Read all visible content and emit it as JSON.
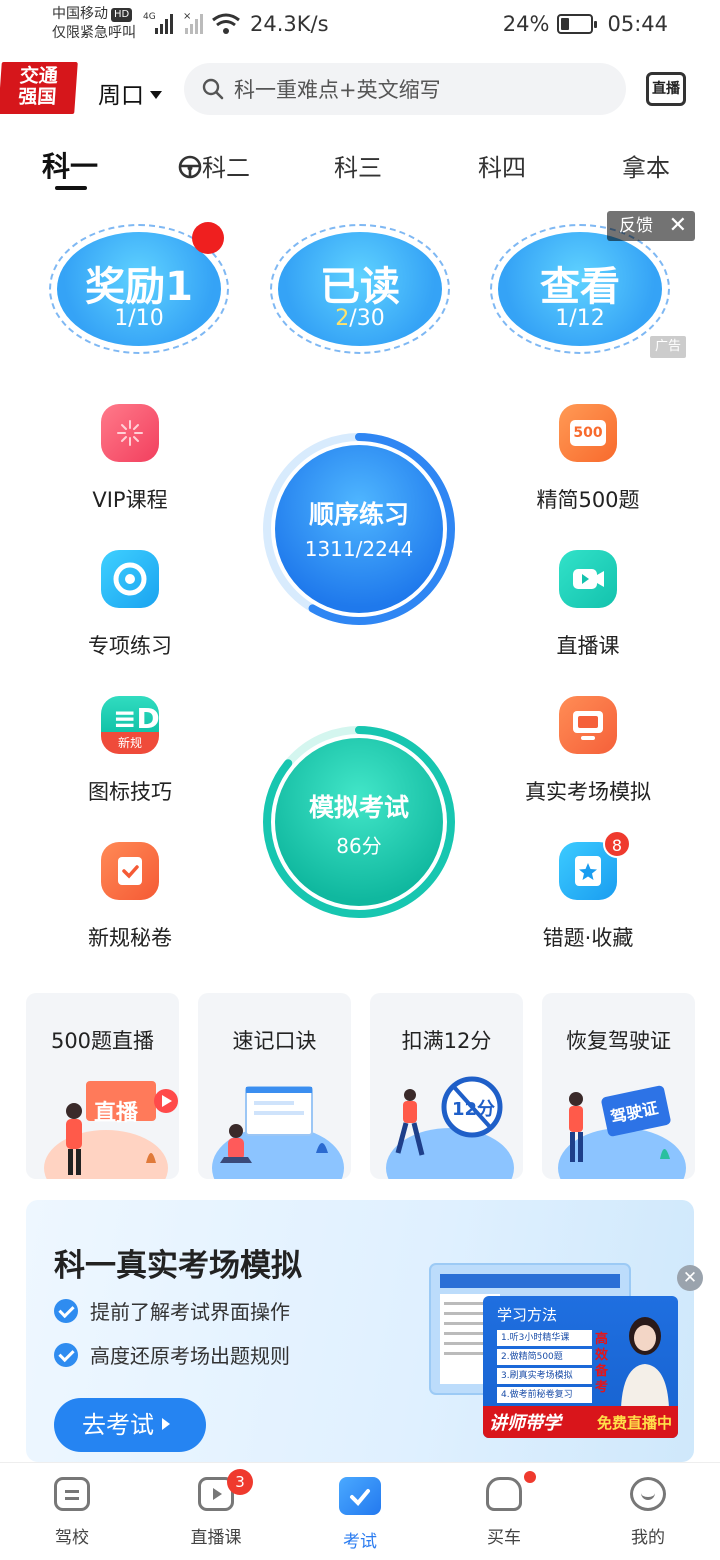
{
  "status": {
    "carrier": "中国移动",
    "carrier_badge": "HD",
    "emergency": "仅限紧急呼叫",
    "net_speed": "24.3K/s",
    "battery": "24%",
    "time": "05:44"
  },
  "header": {
    "logo_line1": "交通",
    "logo_line2": "强国",
    "city": "周口",
    "search_placeholder": "科一重难点+英文缩写",
    "live_label": "直播"
  },
  "tabs": [
    {
      "label": "科一",
      "active": true
    },
    {
      "label": "科二",
      "active": false
    },
    {
      "label": "科三",
      "active": false
    },
    {
      "label": "科四",
      "active": false
    },
    {
      "label": "拿本",
      "active": false
    }
  ],
  "bubbles": [
    {
      "title": "奖励1",
      "value_prefix": "",
      "value_highlight": "1",
      "value_suffix": "/10"
    },
    {
      "title": "已读",
      "value_prefix": "",
      "value_highlight": "2",
      "value_suffix": "/30"
    },
    {
      "title": "查看",
      "value_prefix": "",
      "value_highlight": "1",
      "value_suffix": "/12"
    }
  ],
  "ad": {
    "feedback": "反馈",
    "close": "✕",
    "tag": "广告"
  },
  "features_left": [
    {
      "label": "VIP课程"
    },
    {
      "label": "专项练习"
    },
    {
      "label": "图标技巧",
      "badge_text": "新规"
    },
    {
      "label": "新规秘卷"
    }
  ],
  "features_right": [
    {
      "label": "精简500题",
      "icon_text": "500"
    },
    {
      "label": "直播课"
    },
    {
      "label": "真实考场模拟"
    },
    {
      "label": "错题·收藏",
      "badge": "8"
    }
  ],
  "practice": {
    "title": "顺序练习",
    "progress": "1311/2244",
    "progress_ratio": 0.584
  },
  "exam": {
    "title": "模拟考试",
    "score": "86分",
    "score_ratio": 0.86
  },
  "cards": [
    {
      "title": "500题直播",
      "art_text": "直播"
    },
    {
      "title": "速记口诀"
    },
    {
      "title": "扣满12分",
      "art_text": "12分"
    },
    {
      "title": "恢复驾驶证",
      "art_text": "驾驶证"
    }
  ],
  "banner": {
    "title": "科一真实考场模拟",
    "points": [
      "提前了解考试界面操作",
      "高度还原考场出题规则"
    ],
    "button": "去考试",
    "teach_heading": "学习方法",
    "teach_rows": [
      "1.听3小时精华课",
      "2.做精简500题",
      "3.刷真实考场模拟",
      "4.做考前秘卷复习"
    ],
    "teach_side": "高效备考",
    "teach_strip_left": "讲师带学",
    "teach_strip_right": "免费直播中",
    "close": "✕"
  },
  "bottom_nav": [
    {
      "label": "驾校"
    },
    {
      "label": "直播课",
      "badge": "3"
    },
    {
      "label": "考试",
      "active": true
    },
    {
      "label": "买车",
      "dot": true
    },
    {
      "label": "我的"
    }
  ],
  "colors": {
    "accent": "#2b7cf0",
    "practice_blue": "#2f86f3",
    "exam_teal": "#17c6b0",
    "badge_red": "#ef3a2e"
  }
}
